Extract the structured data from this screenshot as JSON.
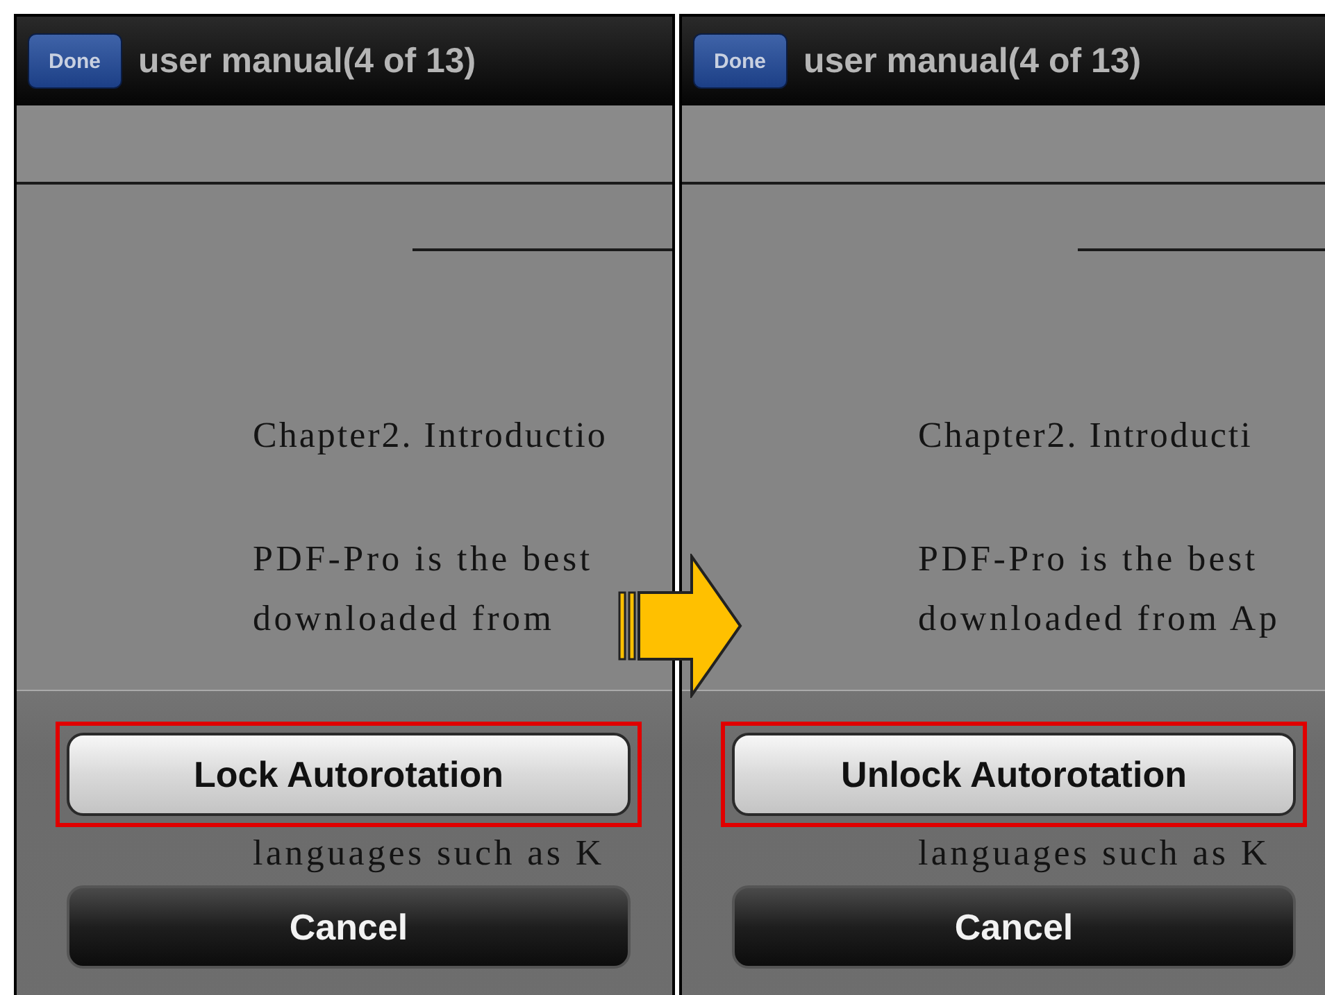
{
  "panels": [
    {
      "nav_bar": {
        "done_button": "Done",
        "title": "user manual(4 of 13)"
      },
      "document": {
        "heading": "Chapter2. Introductio",
        "lines": [
          "PDF-Pro is the best",
          "downloaded from"
        ],
        "covered_lines": [
          "languages such as K"
        ]
      },
      "action_sheet": {
        "buttons": [
          {
            "label": "Lock Autorotation",
            "kind": "default",
            "highlighted": true
          },
          {
            "label": "Cancel",
            "kind": "cancel",
            "highlighted": false
          }
        ]
      }
    },
    {
      "nav_bar": {
        "done_button": "Done",
        "title": "user manual(4 of 13)"
      },
      "document": {
        "heading": "Chapter2. Introducti",
        "lines": [
          "PDF-Pro is the best",
          "downloaded from Ap"
        ],
        "covered_lines": [
          "languages such as K"
        ]
      },
      "action_sheet": {
        "buttons": [
          {
            "label": "Unlock Autorotation",
            "kind": "default",
            "highlighted": true
          },
          {
            "label": "Cancel",
            "kind": "cancel",
            "highlighted": false
          }
        ]
      }
    }
  ]
}
